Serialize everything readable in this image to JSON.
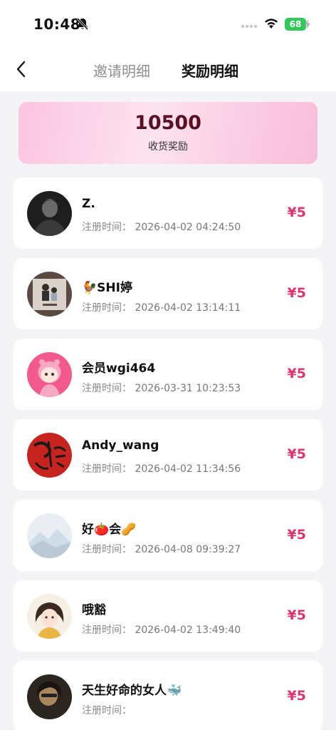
{
  "status_bar": {
    "time": "10:48",
    "battery": "68"
  },
  "nav": {
    "tabs": [
      {
        "label": "邀请明细",
        "active": false
      },
      {
        "label": "奖励明细",
        "active": true
      }
    ]
  },
  "summary": {
    "value": "10500",
    "label": "收货奖励"
  },
  "colors": {
    "accent": "#e0346d",
    "summary_value": "#5a0f22"
  },
  "records": [
    {
      "name": "Z.",
      "reg_label": "注册时间：",
      "reg_time": "2026-04-02 04:24:50",
      "reward": "¥5"
    },
    {
      "name": "🐓SHI婷",
      "reg_label": "注册时间：",
      "reg_time": "2026-04-02 13:14:11",
      "reward": "¥5"
    },
    {
      "name": "会员wgi464",
      "reg_label": "注册时间：",
      "reg_time": "2026-03-31 10:23:53",
      "reward": "¥5"
    },
    {
      "name": "Andy_wang",
      "reg_label": "注册时间：",
      "reg_time": "2026-04-02 11:34:56",
      "reward": "¥5"
    },
    {
      "name": "好🍅会🥜",
      "reg_label": "注册时间：",
      "reg_time": "2026-04-08 09:39:27",
      "reward": "¥5"
    },
    {
      "name": "哦豁",
      "reg_label": "注册时间：",
      "reg_time": "2026-04-02 13:49:40",
      "reward": "¥5"
    },
    {
      "name": "天生好命的女人🐳",
      "reg_label": "注册时间：",
      "reg_time": "",
      "reward": "¥5"
    }
  ]
}
